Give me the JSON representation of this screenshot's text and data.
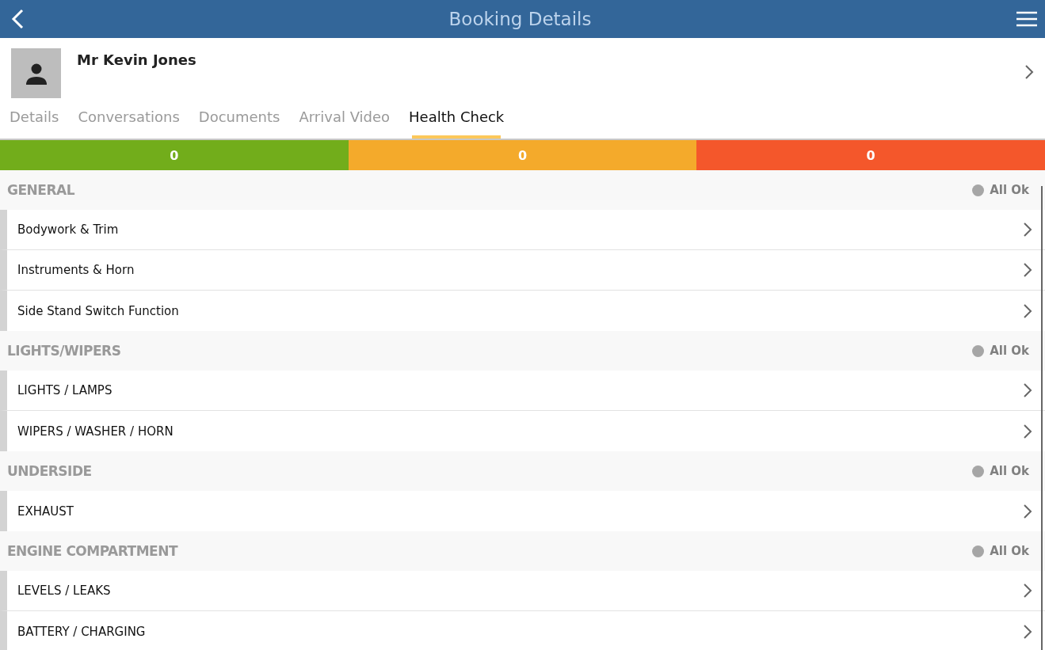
{
  "header": {
    "title": "Booking Details"
  },
  "customer": {
    "name": "Mr Kevin Jones"
  },
  "tabs": [
    {
      "label": "Details",
      "selected": false
    },
    {
      "label": "Conversations",
      "selected": false
    },
    {
      "label": "Documents",
      "selected": false
    },
    {
      "label": "Arrival Video",
      "selected": false
    },
    {
      "label": "Health Check",
      "selected": true
    }
  ],
  "counts": [
    {
      "value": "0",
      "color": "#72ad1b"
    },
    {
      "value": "0",
      "color": "#f4aa2b"
    },
    {
      "value": "0",
      "color": "#f4572b"
    }
  ],
  "sections": [
    {
      "title": "GENERAL",
      "status": "All Ok",
      "color": "#a6a6a6",
      "items": [
        "Bodywork & Trim",
        "Instruments & Horn",
        "Side Stand Switch Function"
      ]
    },
    {
      "title": "LIGHTS/WIPERS",
      "status": "All Ok",
      "color": "#a6a6a6",
      "items": [
        "LIGHTS / LAMPS",
        "WIPERS / WASHER / HORN"
      ]
    },
    {
      "title": "UNDERSIDE",
      "status": "All Ok",
      "color": "#a6a6a6",
      "items": [
        "EXHAUST"
      ]
    },
    {
      "title": "ENGINE COMPARTMENT",
      "status": "All Ok",
      "color": "#a6a6a6",
      "items": [
        "LEVELS / LEAKS",
        "BATTERY / CHARGING"
      ]
    }
  ]
}
